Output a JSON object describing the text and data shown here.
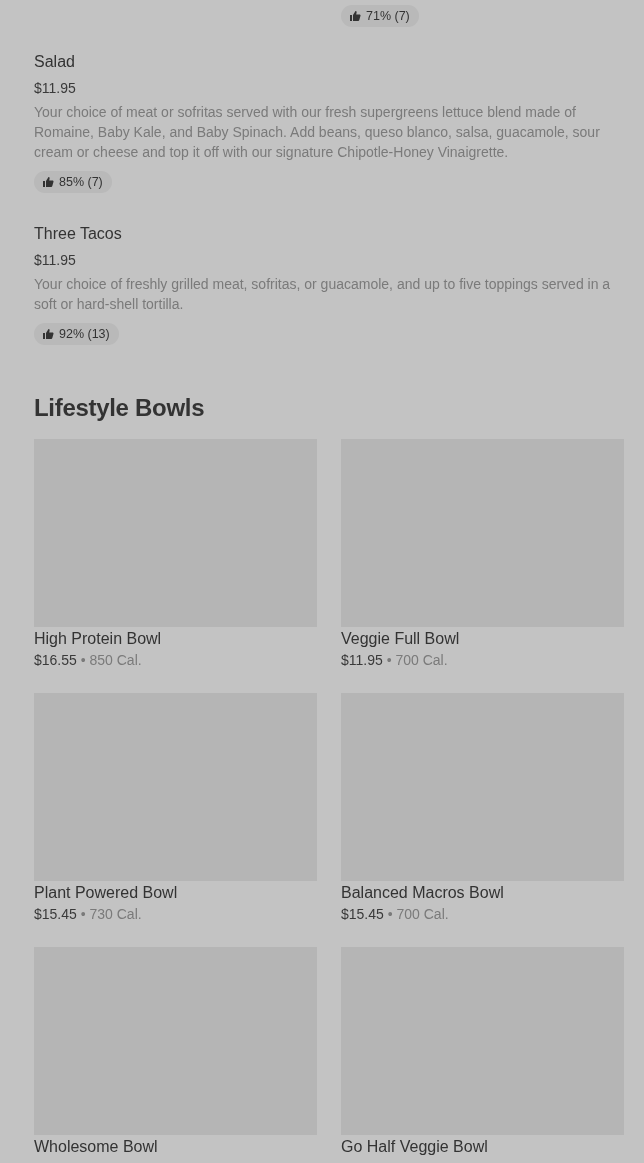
{
  "previous_row": [
    {
      "kind": "hidden"
    },
    {
      "kind": "rating",
      "rating": "71% (7)"
    }
  ],
  "items": [
    {
      "name": "Salad",
      "price": "$11.95",
      "description": "Your choice of meat or sofritas served with our fresh supergreens lettuce blend made of Romaine, Baby Kale, and Baby Spinach. Add beans, queso blanco, salsa, guacamole, sour cream or cheese and top it off with our signature Chipotle-Honey Vinaigrette.",
      "rating": "85% (7)"
    },
    {
      "name": "Three Tacos",
      "price": "$11.95",
      "description": "Your choice of freshly grilled meat, sofritas, or guacamole, and up to five toppings served in a soft or hard-shell tortilla.",
      "rating": "92% (13)"
    }
  ],
  "section": {
    "title": "Lifestyle Bowls",
    "cards": [
      {
        "name": "High Protein Bowl",
        "price": "$16.55",
        "separator": "•",
        "calories": "850 Cal."
      },
      {
        "name": "Veggie Full Bowl",
        "price": "$11.95",
        "separator": "•",
        "calories": "700 Cal."
      },
      {
        "name": "Plant Powered Bowl",
        "price": "$15.45",
        "separator": "•",
        "calories": "730 Cal."
      },
      {
        "name": "Balanced Macros Bowl",
        "price": "$15.45",
        "separator": "•",
        "calories": "700 Cal."
      },
      {
        "name": "Wholesome Bowl"
      },
      {
        "name": "Go Half Veggie Bowl"
      }
    ]
  }
}
